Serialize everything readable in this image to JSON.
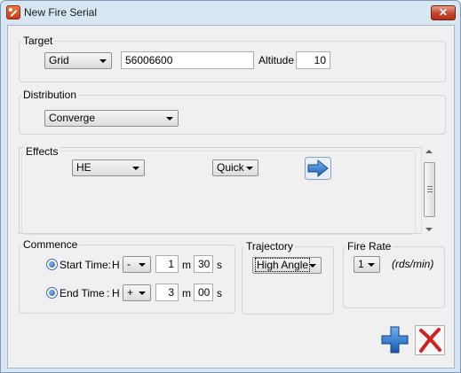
{
  "window": {
    "title": "New Fire Serial",
    "close_label": "✕"
  },
  "target": {
    "label": "Target",
    "type_value": "Grid",
    "grid_value": "56006600",
    "altitude_label": "Altitude",
    "altitude_value": "10"
  },
  "distribution": {
    "label": "Distribution",
    "value": "Converge"
  },
  "effects": {
    "label": "Effects",
    "munition_value": "HE",
    "speed_value": "Quick",
    "next_icon": "arrow-right-icon"
  },
  "commence": {
    "label": "Commence",
    "start": {
      "label": "Start Time:",
      "h_label": "H",
      "sign": "-",
      "value": "1",
      "m_label": "m",
      "seconds": "30",
      "s_label": "s",
      "checked": true
    },
    "end": {
      "label": "End Time",
      "colon": ":",
      "h_label": "H",
      "sign": "+",
      "value": "3",
      "m_label": "m",
      "seconds": "00",
      "s_label": "s",
      "checked": true
    }
  },
  "trajectory": {
    "label": "Trajectory",
    "value": "High Angle"
  },
  "fire_rate": {
    "label": "Fire Rate",
    "value": "1",
    "unit": "(rds/min)"
  },
  "actions": {
    "add_icon": "plus-icon",
    "cancel_icon": "cross-icon"
  },
  "colors": {
    "title_bar": "#d8e6f4",
    "client_bg": "#f0f0f0",
    "accent_blue": "#1e6ec8",
    "close_red": "#c4442b",
    "cancel_red": "#d02020"
  }
}
